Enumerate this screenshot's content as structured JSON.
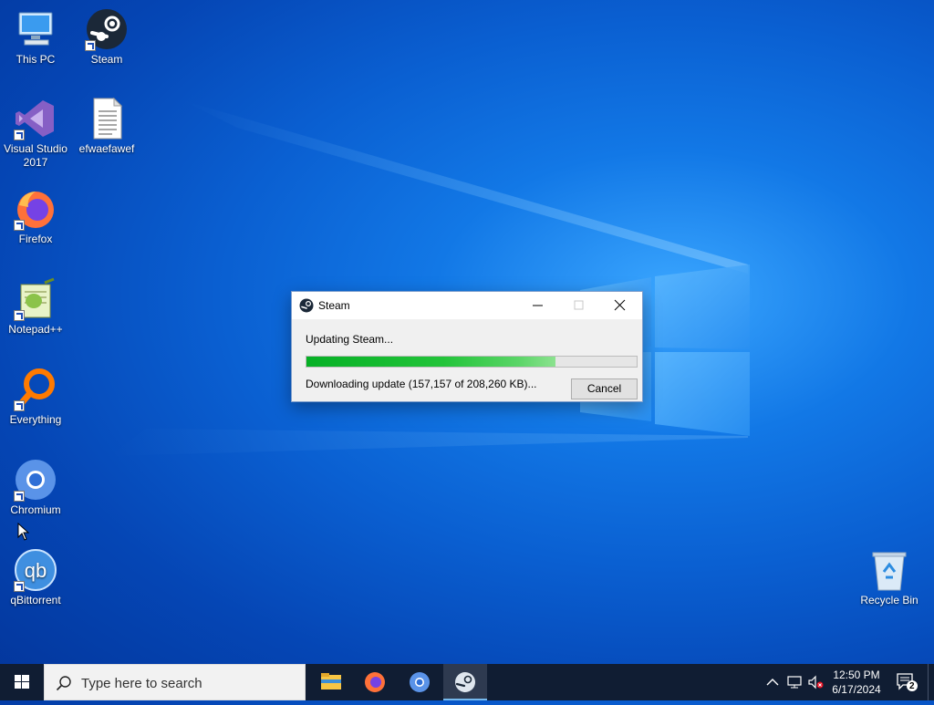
{
  "desktop": {
    "icons": [
      {
        "label": "This PC",
        "icon": "computer-icon"
      },
      {
        "label": "Steam",
        "icon": "steam-icon"
      },
      {
        "label": "Visual Studio 2017",
        "icon": "visual-studio-icon"
      },
      {
        "label": "efwaefawef",
        "icon": "text-file-icon"
      },
      {
        "label": "Firefox",
        "icon": "firefox-icon"
      },
      {
        "label": "Notepad++",
        "icon": "notepad-plus-plus-icon"
      },
      {
        "label": "Everything",
        "icon": "everything-search-icon"
      },
      {
        "label": "Chromium",
        "icon": "chromium-icon"
      },
      {
        "label": "qBittorrent",
        "icon": "qbittorrent-icon"
      },
      {
        "label": "Recycle Bin",
        "icon": "recycle-bin-icon"
      }
    ]
  },
  "dialog": {
    "title": "Steam",
    "status": "Updating Steam...",
    "download_text": "Downloading update (157,157 of 208,260 KB)...",
    "progress_fraction": 0.7546,
    "cancel_label": "Cancel",
    "progress_color": "#06b025"
  },
  "taskbar": {
    "search_placeholder": "Type here to search",
    "pinned": [
      "file-explorer-icon",
      "firefox-icon",
      "chromium-icon",
      "steam-icon"
    ],
    "active_app": "steam-icon",
    "time": "12:50 PM",
    "date": "6/17/2024",
    "notification_count": "2"
  }
}
